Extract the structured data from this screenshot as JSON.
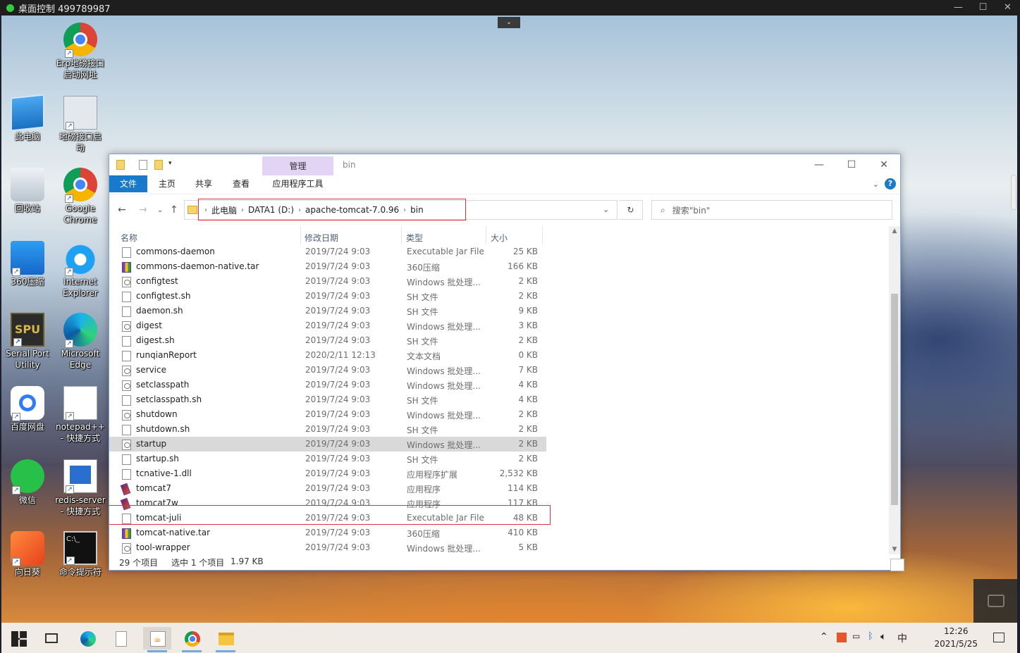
{
  "remote": {
    "title": "桌面控制 499789987",
    "controls": [
      "—",
      "☐",
      "✕"
    ],
    "dropdown": "⌄"
  },
  "desktop_icons": [
    {
      "label": "Erp地磅接口\n启动网址",
      "icon": "chrome-icon"
    },
    {
      "label": "此电脑",
      "icon": "this-pc-icon"
    },
    {
      "label": "地磅接口启\n动",
      "icon": "settings-shortcut-icon"
    },
    {
      "label": "回收站",
      "icon": "recycle-bin-icon"
    },
    {
      "label": "Google\nChrome",
      "icon": "chrome-icon"
    },
    {
      "label": "360压缩",
      "icon": "archive-icon"
    },
    {
      "label": "Internet\nExplorer",
      "icon": "ie-icon"
    },
    {
      "label": "Serial Port\nUtility",
      "icon": "spu-icon"
    },
    {
      "label": "Microsoft\nEdge",
      "icon": "edge-icon"
    },
    {
      "label": "百度网盘",
      "icon": "baidu-netdisk-icon"
    },
    {
      "label": "notepad++\n- 快捷方式",
      "icon": "file-shortcut-icon"
    },
    {
      "label": "微信",
      "icon": "wechat-icon"
    },
    {
      "label": "redis-server\n- 快捷方式",
      "icon": "redis-icon"
    },
    {
      "label": "向日葵",
      "icon": "sunlogin-icon"
    },
    {
      "label": "命令提示符",
      "icon": "cmd-icon"
    }
  ],
  "explorer": {
    "title": "bin",
    "manage_tab": "管理",
    "ribbon_tabs": [
      "文件",
      "主页",
      "共享",
      "查看",
      "应用程序工具"
    ],
    "window_controls": [
      "—",
      "☐",
      "✕"
    ],
    "breadcrumb": [
      "此电脑",
      "DATA1 (D:)",
      "apache-tomcat-7.0.96",
      "bin"
    ],
    "search_placeholder": "搜索\"bin\"",
    "columns": [
      "名称",
      "修改日期",
      "类型",
      "大小"
    ],
    "files": [
      {
        "name": "commons-daemon",
        "date": "2019/7/24 9:03",
        "type": "Executable Jar File",
        "size": "25 KB",
        "icon": "jar"
      },
      {
        "name": "commons-daemon-native.tar",
        "date": "2019/7/24 9:03",
        "type": "360压缩",
        "size": "166 KB",
        "icon": "rar"
      },
      {
        "name": "configtest",
        "date": "2019/7/24 9:03",
        "type": "Windows 批处理...",
        "size": "2 KB",
        "icon": "bat"
      },
      {
        "name": "configtest.sh",
        "date": "2019/7/24 9:03",
        "type": "SH 文件",
        "size": "2 KB",
        "icon": "file"
      },
      {
        "name": "daemon.sh",
        "date": "2019/7/24 9:03",
        "type": "SH 文件",
        "size": "9 KB",
        "icon": "file"
      },
      {
        "name": "digest",
        "date": "2019/7/24 9:03",
        "type": "Windows 批处理...",
        "size": "3 KB",
        "icon": "bat"
      },
      {
        "name": "digest.sh",
        "date": "2019/7/24 9:03",
        "type": "SH 文件",
        "size": "2 KB",
        "icon": "file"
      },
      {
        "name": "runqianReport",
        "date": "2020/2/11 12:13",
        "type": "文本文档",
        "size": "0 KB",
        "icon": "txt"
      },
      {
        "name": "service",
        "date": "2019/7/24 9:03",
        "type": "Windows 批处理...",
        "size": "7 KB",
        "icon": "bat"
      },
      {
        "name": "setclasspath",
        "date": "2019/7/24 9:03",
        "type": "Windows 批处理...",
        "size": "4 KB",
        "icon": "bat"
      },
      {
        "name": "setclasspath.sh",
        "date": "2019/7/24 9:03",
        "type": "SH 文件",
        "size": "4 KB",
        "icon": "file"
      },
      {
        "name": "shutdown",
        "date": "2019/7/24 9:03",
        "type": "Windows 批处理...",
        "size": "2 KB",
        "icon": "bat"
      },
      {
        "name": "shutdown.sh",
        "date": "2019/7/24 9:03",
        "type": "SH 文件",
        "size": "2 KB",
        "icon": "file"
      },
      {
        "name": "startup",
        "date": "2019/7/24 9:03",
        "type": "Windows 批处理...",
        "size": "2 KB",
        "icon": "bat",
        "selected": true
      },
      {
        "name": "startup.sh",
        "date": "2019/7/24 9:03",
        "type": "SH 文件",
        "size": "2 KB",
        "icon": "file"
      },
      {
        "name": "tcnative-1.dll",
        "date": "2019/7/24 9:03",
        "type": "应用程序扩展",
        "size": "2,532 KB",
        "icon": "dll"
      },
      {
        "name": "tomcat7",
        "date": "2019/7/24 9:03",
        "type": "应用程序",
        "size": "114 KB",
        "icon": "exe"
      },
      {
        "name": "tomcat7w",
        "date": "2019/7/24 9:03",
        "type": "应用程序",
        "size": "117 KB",
        "icon": "exe"
      },
      {
        "name": "tomcat-juli",
        "date": "2019/7/24 9:03",
        "type": "Executable Jar File",
        "size": "48 KB",
        "icon": "jar"
      },
      {
        "name": "tomcat-native.tar",
        "date": "2019/7/24 9:03",
        "type": "360压缩",
        "size": "410 KB",
        "icon": "rar"
      },
      {
        "name": "tool-wrapper",
        "date": "2019/7/24 9:03",
        "type": "Windows 批处理...",
        "size": "5 KB",
        "icon": "bat"
      }
    ],
    "status": {
      "count": "29 个项目",
      "selection": "选中 1 个项目",
      "size": "1.97 KB"
    }
  },
  "taskbar": {
    "apps": [
      "start-icon",
      "task-view-icon",
      "edge-icon",
      "file-icon",
      "java-icon",
      "chrome-icon",
      "file-explorer-icon"
    ],
    "ime": "中",
    "time": "12:26",
    "date": "2021/5/25"
  },
  "colors": {
    "accent": "#1979ca",
    "highlight_box": "#d9343f",
    "manage_tab": "#e3d3f5",
    "selected_row": "#d9d9d9"
  }
}
